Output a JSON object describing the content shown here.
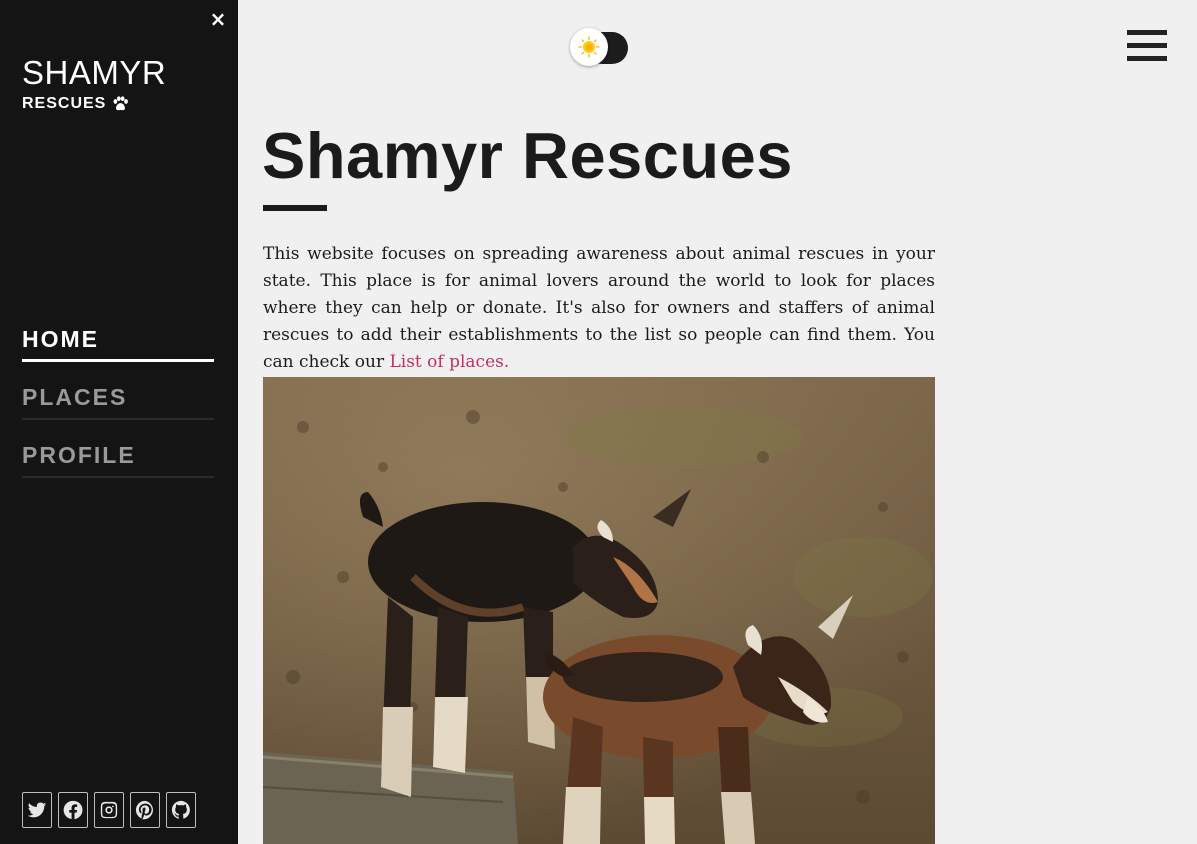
{
  "sidebar": {
    "close_symbol": "×",
    "brand_name": "SHAMYR",
    "brand_sub": "RESCUES",
    "nav": [
      {
        "label": "HOME",
        "active": true
      },
      {
        "label": "PLACES",
        "active": false
      },
      {
        "label": "PROFILE",
        "active": false
      }
    ],
    "social": [
      "twitter-icon",
      "facebook-icon",
      "instagram-icon",
      "pinterest-icon",
      "github-icon"
    ]
  },
  "main": {
    "title": "Shamyr Rescues",
    "intro": "This website focuses on spreading awareness about animal rescues in your state. This place is for animal lovers around the world to look for places where they can help or donate. It's also for owners and staffers of animal rescues to add their establishments to the list so people can find them. You can check our",
    "intro_link": "List of places.",
    "hero_image": "two-baby-goats-photo"
  },
  "theme_toggle": {
    "icon": "sun-icon"
  },
  "colors": {
    "sidebar_bg": "#141414",
    "page_bg": "#f0f0f0",
    "link": "#c0325b",
    "text": "#1b1b1b"
  }
}
